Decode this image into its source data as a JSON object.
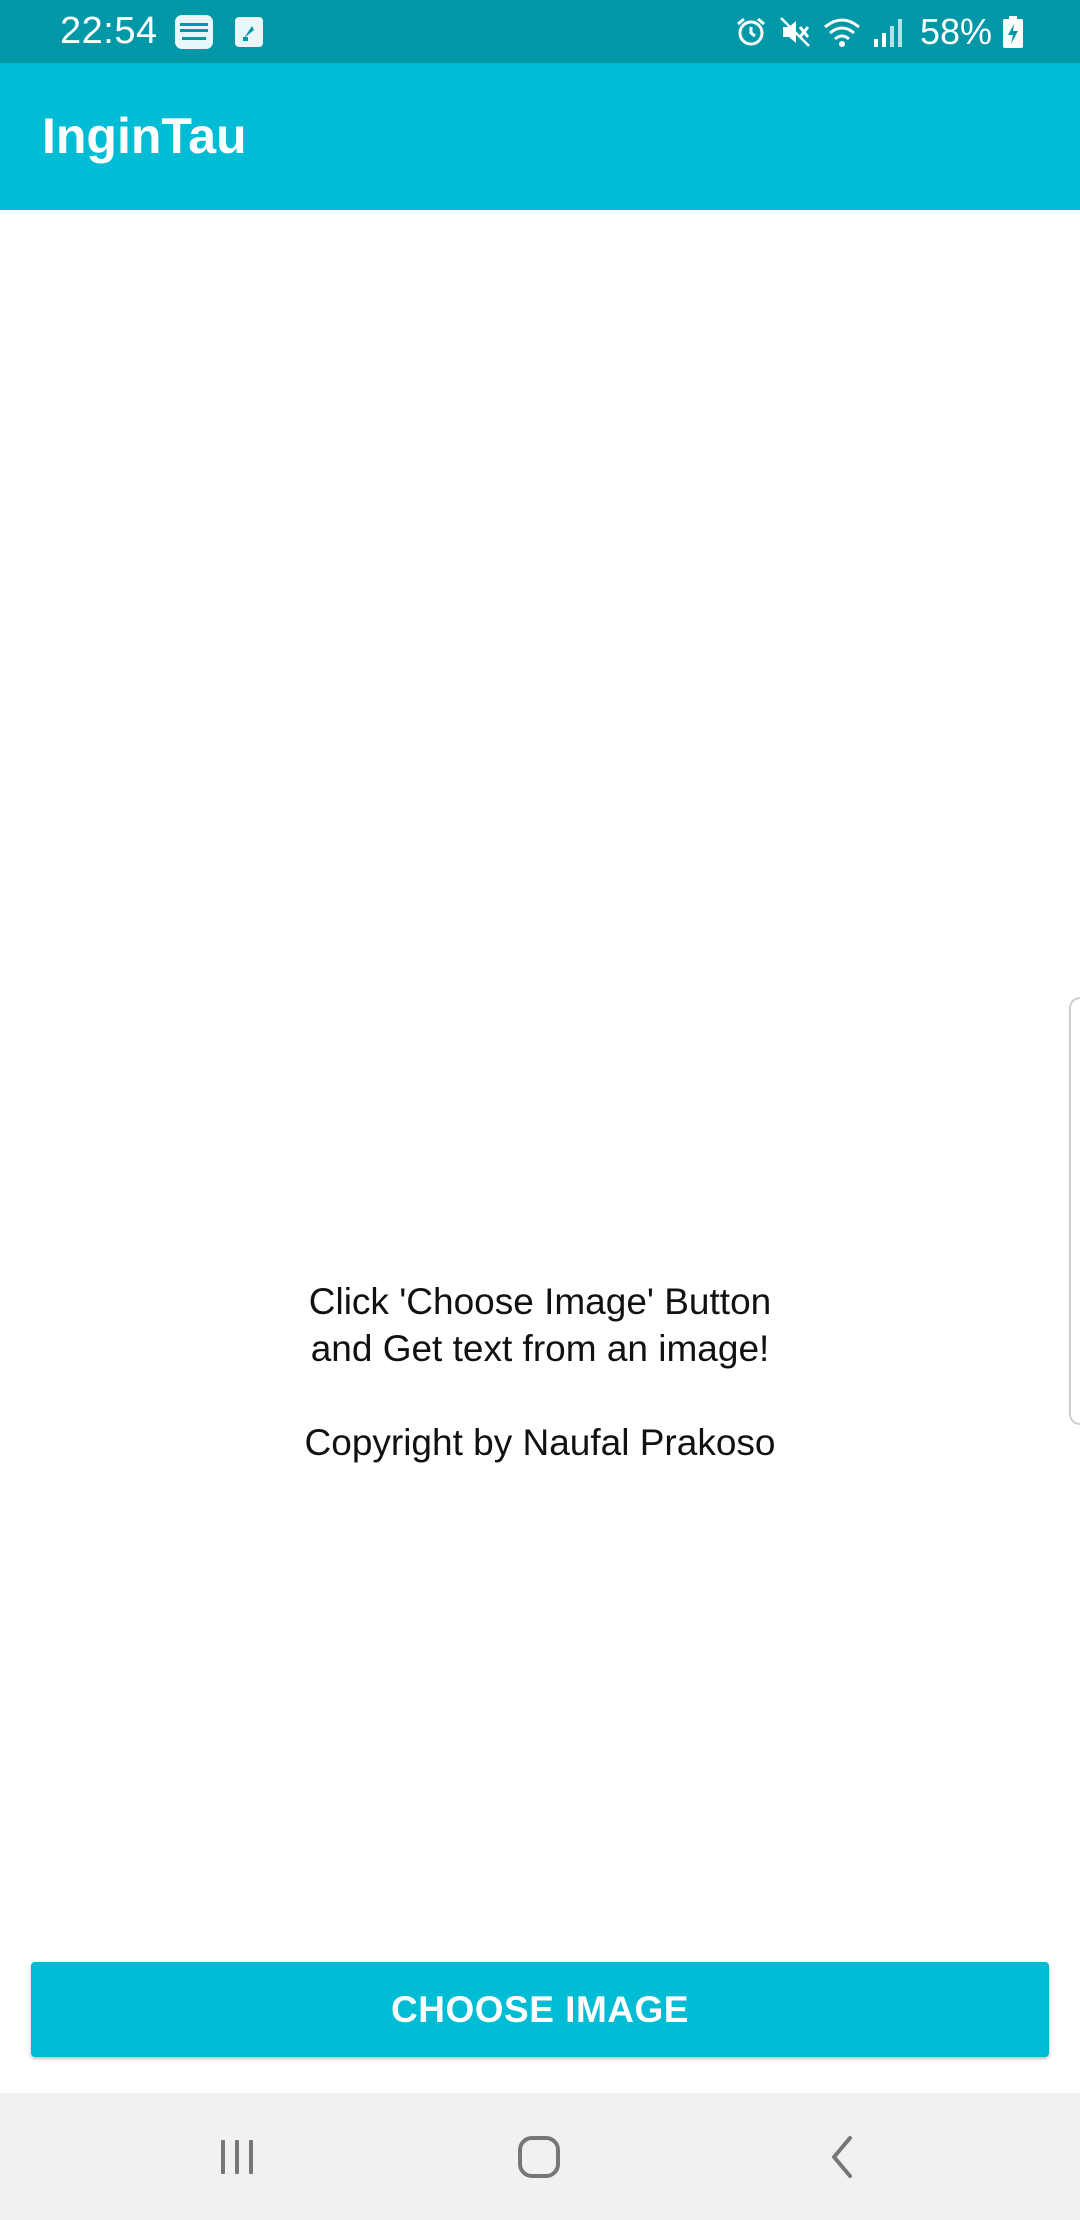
{
  "status_bar": {
    "time": "22:54",
    "notification_icons": [
      "binus-mobile-icon",
      "phone-app-icon"
    ],
    "system_icons": [
      "alarm-icon",
      "mute-icon",
      "wifi-icon",
      "signal-icon"
    ],
    "battery_percent": "58%",
    "color": "#0097a7"
  },
  "app_bar": {
    "title": "InginTau",
    "color": "#00bcd4"
  },
  "content": {
    "line1": "Click 'Choose Image' Button",
    "line2": "and Get text from an image!",
    "copyright": "Copyright by Naufal Prakoso"
  },
  "choose_button": {
    "label": "CHOOSE IMAGE",
    "color": "#00bcd4"
  },
  "nav_bar": {
    "buttons": [
      "recent-apps-icon",
      "home-icon",
      "back-icon"
    ]
  }
}
